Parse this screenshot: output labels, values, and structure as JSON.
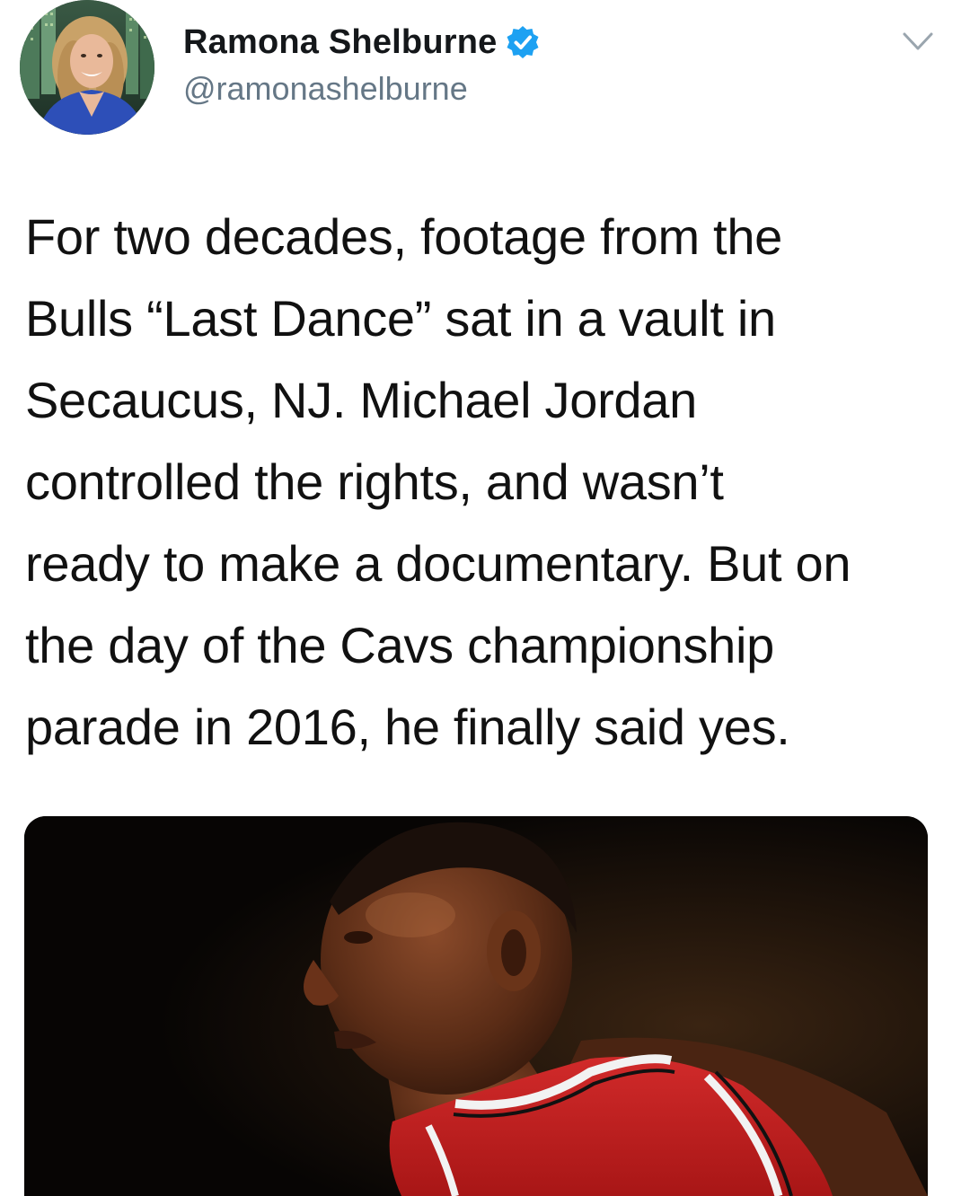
{
  "author": {
    "display_name": "Ramona Shelburne",
    "handle": "@ramonashelburne",
    "verified_icon": "verified-badge-icon",
    "avatar_icon": "profile-photo"
  },
  "menu": {
    "icon": "chevron-down-icon"
  },
  "tweet": {
    "lines": [
      "For two decades, footage from the",
      "Bulls “Last Dance” sat in a vault in",
      "Secaucus, NJ. Michael Jordan",
      "controlled the rights, and wasn’t",
      "ready to make a documentary. But on",
      "the day of the Cavs championship",
      "parade in 2016, he finally said yes."
    ]
  },
  "media": {
    "kind": "photo",
    "subject": "basketball-player-photo"
  },
  "colors": {
    "name": "#14171a",
    "handle": "#657786",
    "verified": "#1da1f2",
    "text": "#111111"
  }
}
